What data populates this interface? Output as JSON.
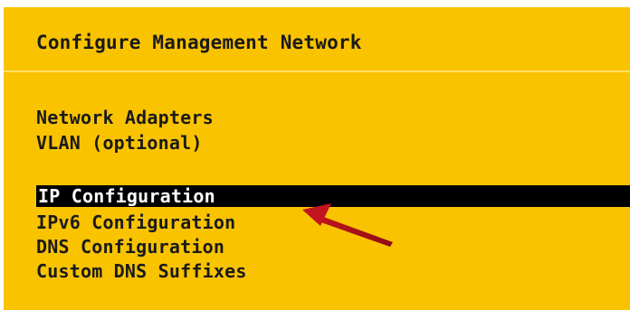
{
  "window": {
    "title": "Configure Management Network"
  },
  "menu": {
    "items": [
      {
        "label": "Network Adapters",
        "selected": false
      },
      {
        "label": "VLAN (optional)",
        "selected": false
      },
      {
        "label": "IP Configuration",
        "selected": true
      },
      {
        "label": "IPv6 Configuration",
        "selected": false
      },
      {
        "label": "DNS Configuration",
        "selected": false
      },
      {
        "label": "Custom DNS Suffixes",
        "selected": false
      }
    ]
  },
  "colors": {
    "background": "#f9c300",
    "text": "#1a1a1a",
    "selection_bg": "#000000",
    "selection_text": "#ffffff",
    "annotation_arrow": "#b5121b"
  },
  "annotation": {
    "icon": "red-arrow-icon",
    "points_to": "IP Configuration"
  }
}
